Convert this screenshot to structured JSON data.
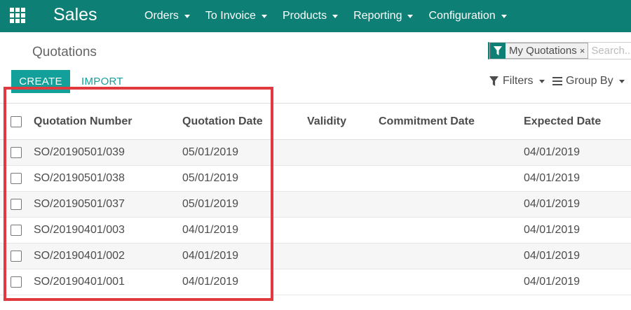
{
  "navbar": {
    "app_name": "Sales",
    "menu": [
      {
        "label": "Orders"
      },
      {
        "label": "To Invoice"
      },
      {
        "label": "Products"
      },
      {
        "label": "Reporting"
      },
      {
        "label": "Configuration"
      }
    ],
    "color": "#0e7f74"
  },
  "control_panel": {
    "title": "Quotations",
    "create_label": "CREATE",
    "import_label": "IMPORT",
    "search": {
      "facet_label": "My Quotations",
      "facet_close": "×",
      "placeholder": "Search..."
    },
    "filters_label": "Filters",
    "groupby_label": "Group By"
  },
  "table": {
    "columns": [
      "Quotation Number",
      "Quotation Date",
      "Validity",
      "Commitment Date",
      "Expected Date"
    ],
    "rows": [
      {
        "number": "SO/20190501/039",
        "date": "05/01/2019",
        "validity": "",
        "commitment": "",
        "expected": "04/01/2019"
      },
      {
        "number": "SO/20190501/038",
        "date": "05/01/2019",
        "validity": "",
        "commitment": "",
        "expected": "04/01/2019"
      },
      {
        "number": "SO/20190501/037",
        "date": "05/01/2019",
        "validity": "",
        "commitment": "",
        "expected": "04/01/2019"
      },
      {
        "number": "SO/20190401/003",
        "date": "04/01/2019",
        "validity": "",
        "commitment": "",
        "expected": "04/01/2019"
      },
      {
        "number": "SO/20190401/002",
        "date": "04/01/2019",
        "validity": "",
        "commitment": "",
        "expected": "04/01/2019"
      },
      {
        "number": "SO/20190401/001",
        "date": "04/01/2019",
        "validity": "",
        "commitment": "",
        "expected": "04/01/2019"
      }
    ]
  },
  "colors": {
    "accent": "#14a09a",
    "highlight": "#e03a3e"
  }
}
